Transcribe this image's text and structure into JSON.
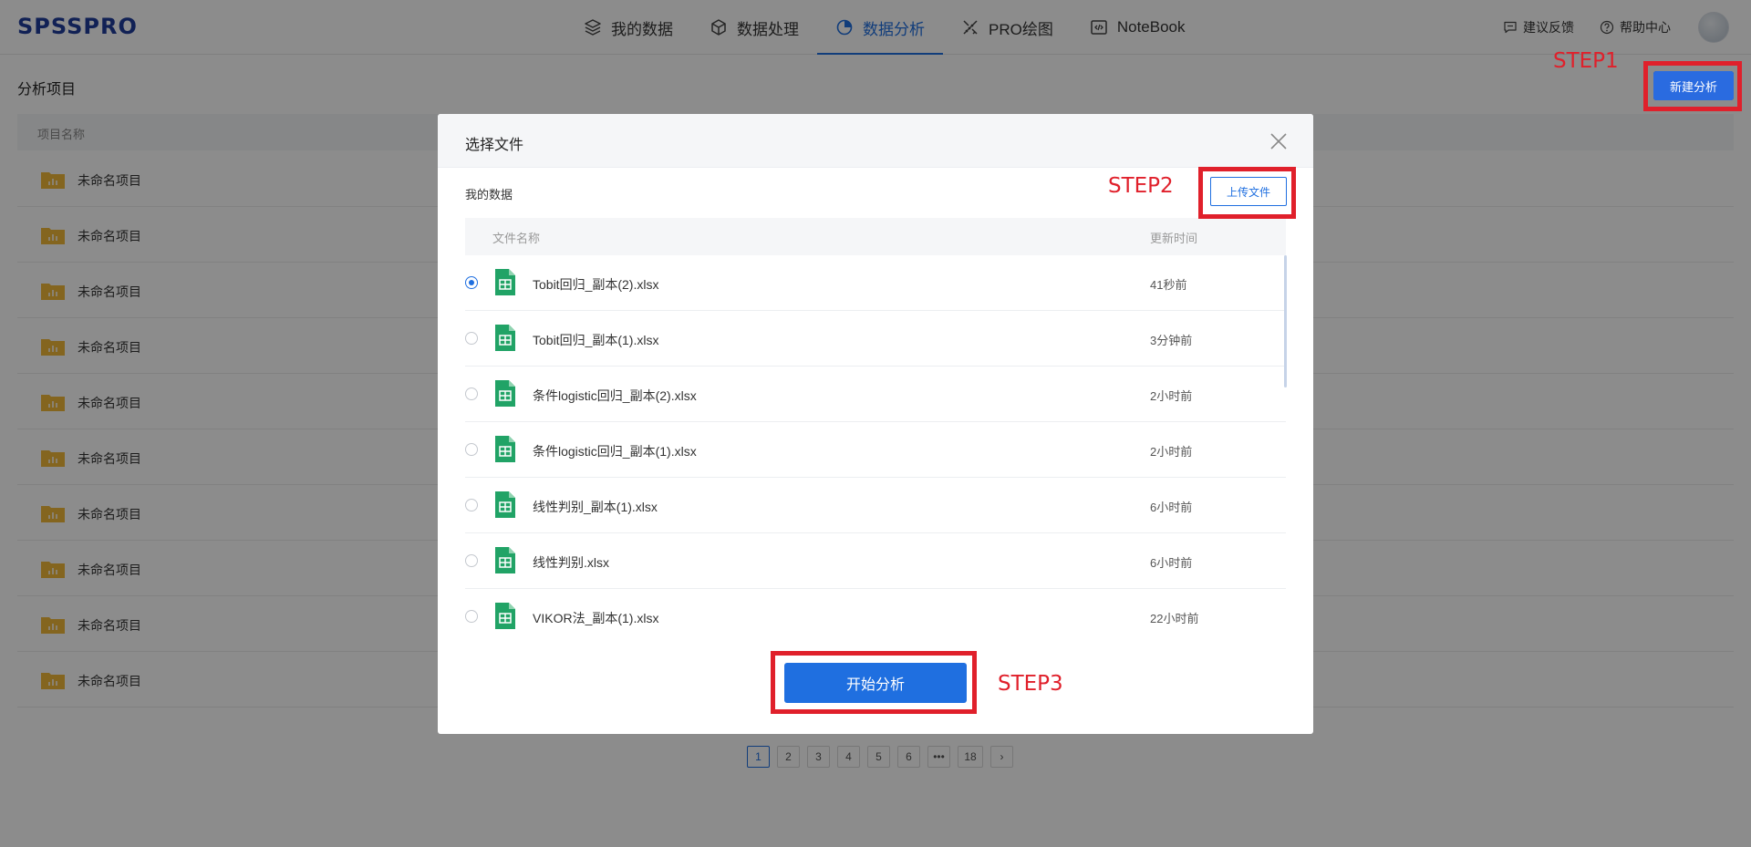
{
  "header": {
    "logo": "SPSSPRO",
    "nav": [
      {
        "label": "我的数据",
        "icon": "layers-icon"
      },
      {
        "label": "数据处理",
        "icon": "cube-icon"
      },
      {
        "label": "数据分析",
        "icon": "pie-chart-icon",
        "active": true
      },
      {
        "label": "PRO绘图",
        "icon": "pencil-ruler-icon"
      },
      {
        "label": "NoteBook",
        "icon": "code-icon"
      }
    ],
    "feedback": "建议反馈",
    "help": "帮助中心"
  },
  "page": {
    "title": "分析项目",
    "new_button": "新建分析",
    "table_header": "项目名称",
    "projects": [
      "未命名项目",
      "未命名项目",
      "未命名项目",
      "未命名项目",
      "未命名项目",
      "未命名项目",
      "未命名项目",
      "未命名项目",
      "未命名项目",
      "未命名项目"
    ]
  },
  "pagination": {
    "pages": [
      "1",
      "2",
      "3",
      "4",
      "5",
      "6",
      "•••",
      "18"
    ],
    "current": "1",
    "next": "›"
  },
  "modal": {
    "title": "选择文件",
    "section": "我的数据",
    "upload_button": "上传文件",
    "col_name": "文件名称",
    "col_time": "更新时间",
    "files": [
      {
        "name": "Tobit回归_副本(2).xlsx",
        "time": "41秒前",
        "selected": true
      },
      {
        "name": "Tobit回归_副本(1).xlsx",
        "time": "3分钟前"
      },
      {
        "name": "条件logistic回归_副本(2).xlsx",
        "time": "2小时前"
      },
      {
        "name": "条件logistic回归_副本(1).xlsx",
        "time": "2小时前"
      },
      {
        "name": "线性判别_副本(1).xlsx",
        "time": "6小时前"
      },
      {
        "name": "线性判别.xlsx",
        "time": "6小时前"
      },
      {
        "name": "VIKOR法_副本(1).xlsx",
        "time": "22小时前"
      }
    ],
    "start_button": "开始分析"
  },
  "annotations": {
    "step1": "STEP1",
    "step2": "STEP2",
    "step3": "STEP3",
    "color": "#e0202b"
  },
  "colors": {
    "brand": "#1f3c9c",
    "accent": "#1f6fe0",
    "folder": "#f0b93a",
    "excel": "#21a366"
  }
}
